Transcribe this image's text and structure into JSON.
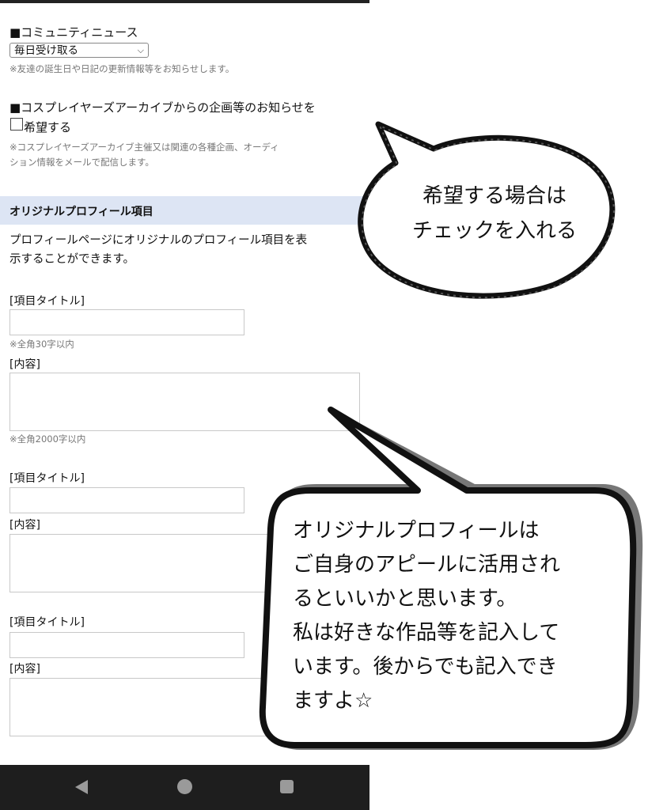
{
  "community_news": {
    "heading": "■コミュニティニュース",
    "select_value": "毎日受け取る",
    "note": "※友達の誕生日や日記の更新情報等をお知らせします。"
  },
  "archive_notice": {
    "heading": "■コスプレイヤーズアーカイブからの企画等のお知らせを",
    "checkbox_label": "希望する",
    "note_line1": "※コスプレイヤーズアーカイブ主催又は関連の各種企画、オーディ",
    "note_line2": "ション情報をメールで配信します。"
  },
  "original_profile": {
    "section_title": "オリジナルプロフィール項目",
    "description_line1": "プロフィールページにオリジナルのプロフィール項目を表",
    "description_line2": "示することができます。",
    "items": [
      {
        "title_label": "[項目タイトル]",
        "title_note": "※全角30字以内",
        "content_label": "[内容]",
        "content_note": "※全角2000字以内"
      },
      {
        "title_label": "[項目タイトル]",
        "content_label": "[内容]"
      },
      {
        "title_label": "[項目タイトル]",
        "content_label": "[内容]"
      }
    ]
  },
  "bubble_1": {
    "line1": "希望する場合は",
    "line2": "チェックを入れる"
  },
  "bubble_2": {
    "lines": [
      "オリジナルプロフィールは",
      "ご自身のアピールに活用され",
      "るといいかと思います。",
      "私は好きな作品等を記入して",
      "います。後からでも記入でき",
      "ますよ☆"
    ]
  },
  "nav": {
    "back_icon": "back-triangle-icon",
    "home_icon": "home-circle-icon",
    "recent_icon": "recent-square-icon"
  }
}
